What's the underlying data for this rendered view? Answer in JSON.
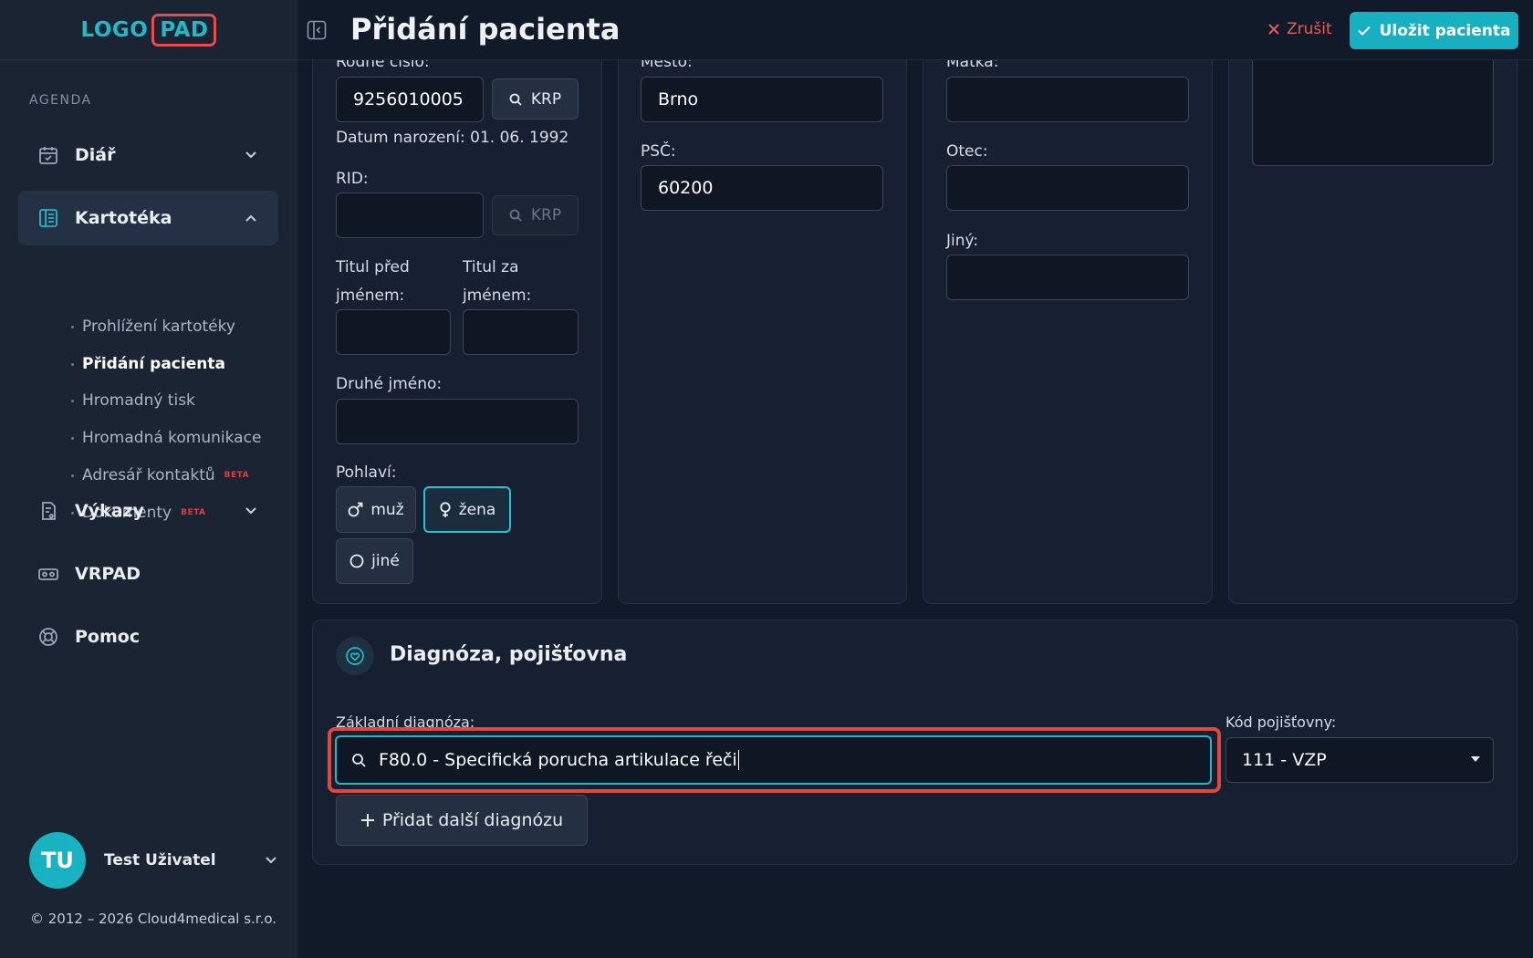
{
  "app": {
    "logo_part1": "LOGO",
    "logo_part2": "PAD"
  },
  "header": {
    "title": "Přidání pacienta",
    "cancel_label": "Zrušit",
    "save_label": "Uložit pacienta"
  },
  "sidebar": {
    "section_label": "AGENDA",
    "items": [
      {
        "label": "Diář",
        "icon": "calendar-check-icon"
      },
      {
        "label": "Kartotéka",
        "icon": "card-file-icon"
      },
      {
        "label": "Výkazy",
        "icon": "report-icon"
      },
      {
        "label": "VRPAD",
        "icon": "vr-headset-icon"
      },
      {
        "label": "Pomoc",
        "icon": "lifebuoy-icon"
      }
    ],
    "subitems": [
      {
        "label": "Prohlížení kartotéky"
      },
      {
        "label": "Přidání pacienta"
      },
      {
        "label": "Hromadný tisk"
      },
      {
        "label": "Hromadná komunikace"
      },
      {
        "label": "Adresář kontaktů",
        "badge": "BETA"
      },
      {
        "label": "Dokumenty",
        "badge": "BETA"
      }
    ],
    "user": {
      "initials": "TU",
      "name": "Test Uživatel"
    },
    "copyright": "© 2012 – 2026 Cloud4medical s.r.o."
  },
  "form": {
    "birth_number": {
      "label": "Rodné číslo:",
      "value": "9256010005",
      "krp_label": "KRP"
    },
    "birth_date": "Datum narození: 01. 06. 1992",
    "rid": {
      "label": "RID:",
      "value": "",
      "krp_label": "KRP"
    },
    "title_before": {
      "label_line1": "Titul před",
      "label_line2": "jménem:",
      "value": ""
    },
    "title_after": {
      "label_line1": "Titul za",
      "label_line2": "jménem:",
      "value": ""
    },
    "second_name": {
      "label": "Druhé jméno:",
      "value": ""
    },
    "gender": {
      "label": "Pohlaví:",
      "options": [
        "muž",
        "žena",
        "jiné"
      ],
      "selected": "žena"
    },
    "city": {
      "label": "Město:",
      "value": "Brno"
    },
    "zip": {
      "label": "PSČ:",
      "value": "60200"
    },
    "mother": {
      "label": "Matka:",
      "value": ""
    },
    "father": {
      "label": "Otec:",
      "value": ""
    },
    "other": {
      "label": "Jiný:",
      "value": ""
    }
  },
  "diagnosis": {
    "section_title": "Diagnóza, pojišťovna",
    "main_label": "Základní diagnóza:",
    "main_value": "F80.0 - Specifická porucha artikulace řeči",
    "add_label": "Přidat další diagnózu",
    "insurance_label": "Kód pojišťovny:",
    "insurance_value": "111 - VZP"
  },
  "colors": {
    "accent": "#17b0c0",
    "danger": "#ec5a55",
    "background": "#111a28",
    "sidebar": "#1b2433"
  }
}
